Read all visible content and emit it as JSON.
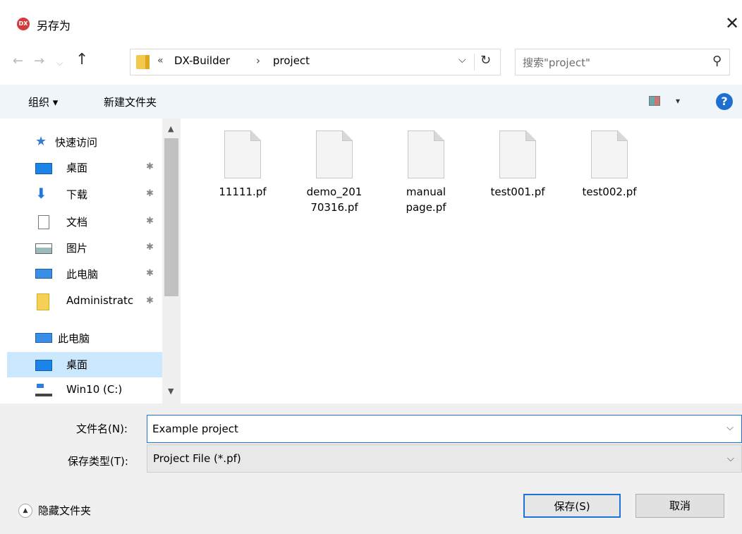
{
  "window": {
    "title": "另存为",
    "app_icon_text": "DX",
    "close_glyph": "✕"
  },
  "nav": {
    "back_glyph": "←",
    "forward_glyph": "→",
    "recent_glyph": "⌵",
    "up_glyph": "↑",
    "breadcrumb": {
      "prefix": "«",
      "crumb1": "DX-Builder",
      "separator": "›",
      "crumb2": "project"
    },
    "dropdown_glyph": "⌵",
    "refresh_glyph": "↻",
    "search_placeholder": "搜索\"project\"",
    "search_glyph": "⚲"
  },
  "toolbar": {
    "organize_label": "组织 ▾",
    "new_folder_label": "新建文件夹",
    "view_dropdown_glyph": "▾",
    "help_glyph": "?"
  },
  "sidebar": {
    "quick_access": "快速访问",
    "items": [
      {
        "label": "桌面",
        "icon": "desktop-icon",
        "pinned": true
      },
      {
        "label": "下载",
        "icon": "download-icon",
        "pinned": true
      },
      {
        "label": "文档",
        "icon": "document-icon",
        "pinned": true
      },
      {
        "label": "图片",
        "icon": "pictures-icon",
        "pinned": true
      },
      {
        "label": "此电脑",
        "icon": "computer-icon",
        "pinned": true
      },
      {
        "label": "Administratc",
        "icon": "folder-icon",
        "pinned": true
      }
    ],
    "this_pc": "此电脑",
    "pc_items": [
      {
        "label": "桌面",
        "icon": "desktop-icon",
        "selected": true
      },
      {
        "label": "Win10 (C:)",
        "icon": "drive-icon",
        "selected": false
      }
    ],
    "pin_glyph": "📌"
  },
  "files": [
    {
      "name": "11111.pf"
    },
    {
      "name": "demo_20170316.pf",
      "line1": "demo_201",
      "line2": "70316.pf"
    },
    {
      "name": "manual page.pf",
      "line1": "manual",
      "line2": "page.pf"
    },
    {
      "name": "test001.pf"
    },
    {
      "name": "test002.pf"
    }
  ],
  "form": {
    "filename_label": "文件名(N):",
    "filename_value": "Example project",
    "filetype_label": "保存类型(T):",
    "filetype_value": "Project File (*.pf)",
    "dropdown_glyph": "⌵"
  },
  "footer": {
    "hide_folders_label": "隐藏文件夹",
    "hide_icon_glyph": "▲",
    "save_label": "保存(S)",
    "cancel_label": "取消"
  }
}
